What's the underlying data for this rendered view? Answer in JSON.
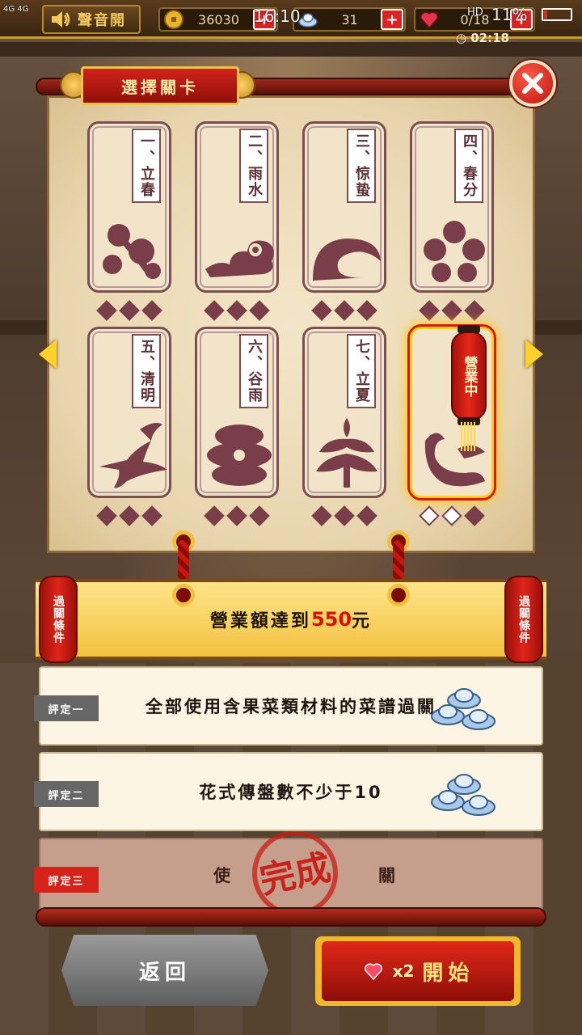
{
  "status_bar": {
    "signal": "4G 4G",
    "time": "16:10",
    "battery_pct": "11%",
    "hd": "HD"
  },
  "top": {
    "sound_label": "聲音開",
    "coins": "36030",
    "silver": "31",
    "hearts": "0/18",
    "timer": "02:18"
  },
  "panel": {
    "title": "選擇關卡"
  },
  "levels": [
    {
      "label": "一、立春",
      "diamonds_filled": 3
    },
    {
      "label": "二、雨水",
      "diamonds_filled": 3
    },
    {
      "label": "三、惊蛰",
      "diamonds_filled": 3
    },
    {
      "label": "四、春分",
      "diamonds_filled": 3
    },
    {
      "label": "五、清明",
      "diamonds_filled": 3
    },
    {
      "label": "六、谷雨",
      "diamonds_filled": 3
    },
    {
      "label": "七、立夏",
      "diamonds_filled": 3
    },
    {
      "label": "",
      "diamonds_filled": 1,
      "active": true
    }
  ],
  "active_lantern": "營業中",
  "condition": {
    "side_label": "過關條件",
    "prefix": "營業額達到",
    "amount": "550",
    "suffix": "元"
  },
  "ratings": [
    {
      "tag": "評定一",
      "text": "全部使用含果菜類材料的菜譜過關",
      "done": false
    },
    {
      "tag": "評定二",
      "text": "花式傳盤數不少于10",
      "done": false
    },
    {
      "tag": "評定三",
      "text": "使",
      "text_tail": "關",
      "done": true
    }
  ],
  "stamp_text": "完成",
  "buttons": {
    "back": "返回",
    "start_cost": "x2",
    "start": "開始"
  }
}
